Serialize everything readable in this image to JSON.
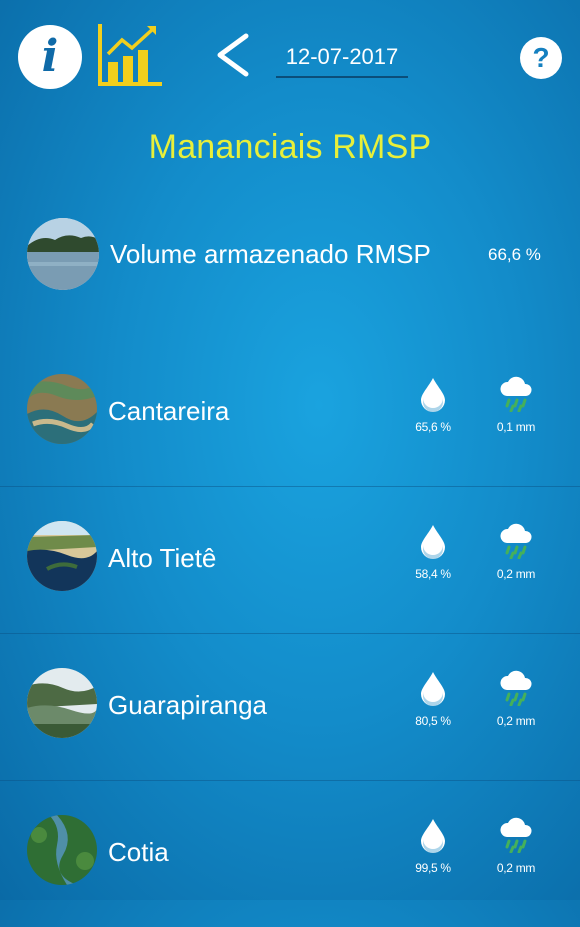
{
  "header": {
    "date": "12-07-2017",
    "info_label": "i",
    "help_label": "?"
  },
  "title": "Mananciais RMSP",
  "summary": {
    "name": "Volume armazenado RMSP",
    "value": "66,6 %"
  },
  "reservoirs": [
    {
      "name": "Cantareira",
      "volume": "65,6 %",
      "rain": "0,1 mm"
    },
    {
      "name": "Alto Tietê",
      "volume": "58,4 %",
      "rain": "0,2 mm"
    },
    {
      "name": "Guarapiranga",
      "volume": "80,5 %",
      "rain": "0,2 mm"
    },
    {
      "name": "Cotia",
      "volume": "99,5 %",
      "rain": "0,2 mm"
    }
  ],
  "colors": {
    "title": "#e8ef3a",
    "chart_icon": "#f2cf1d",
    "rain_drop": "#45b05a"
  },
  "icons": [
    "info-icon",
    "bar-chart-icon",
    "back-arrow-icon",
    "help-icon",
    "water-drop-icon",
    "rain-cloud-icon"
  ]
}
